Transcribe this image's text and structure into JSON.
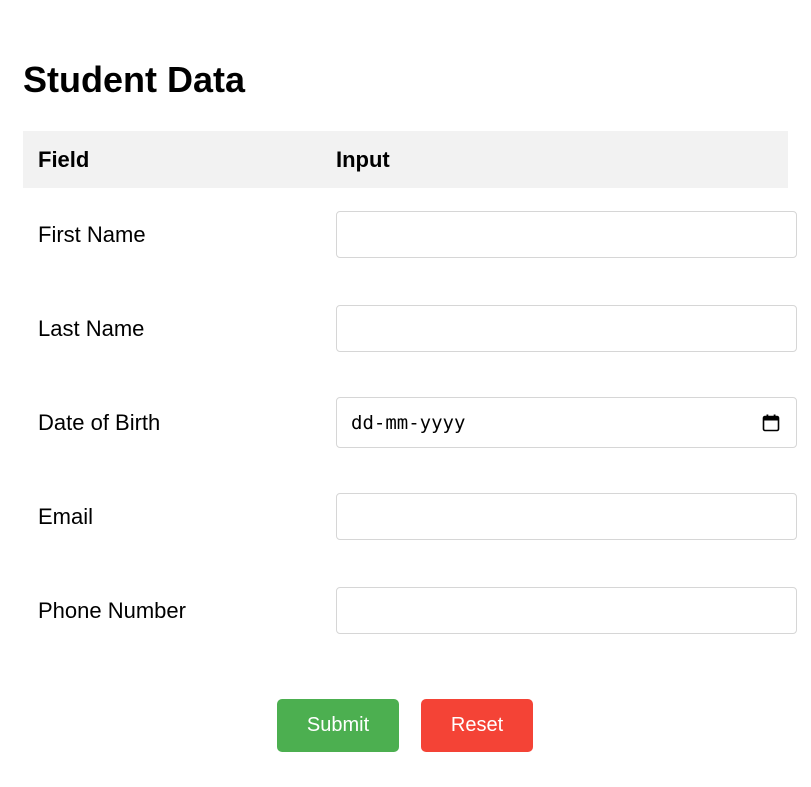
{
  "page": {
    "title": "Student Data"
  },
  "table": {
    "headers": {
      "field": "Field",
      "input": "Input"
    },
    "rows": [
      {
        "label": "First Name",
        "value": ""
      },
      {
        "label": "Last Name",
        "value": ""
      },
      {
        "label": "Date of Birth",
        "placeholder": "dd-mm-yyyy",
        "icon": "calendar-icon"
      },
      {
        "label": "Email",
        "value": ""
      },
      {
        "label": "Phone Number",
        "value": ""
      }
    ]
  },
  "buttons": {
    "submit_label": "Submit",
    "reset_label": "Reset"
  },
  "colors": {
    "header_background": "#f2f2f2",
    "submit_background": "#4caf50",
    "reset_background": "#f44336",
    "input_border": "#d6d6d6"
  }
}
